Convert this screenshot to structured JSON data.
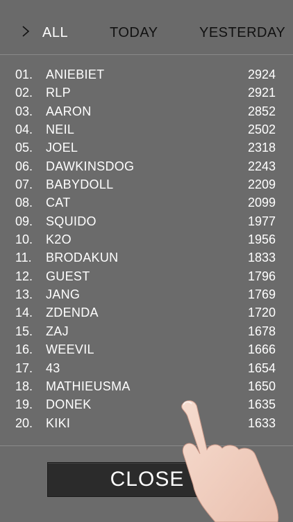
{
  "tabs": {
    "all": "ALL",
    "today": "TODAY",
    "yesterday": "YESTERDAY",
    "arrow_icon": "chevron-right-icon"
  },
  "leaderboard": [
    {
      "rank": "01.",
      "name": "ANIEBIET",
      "score": "2924"
    },
    {
      "rank": "02.",
      "name": "RLP",
      "score": "2921"
    },
    {
      "rank": "03.",
      "name": "AARON",
      "score": "2852"
    },
    {
      "rank": "04.",
      "name": "NEIL",
      "score": "2502"
    },
    {
      "rank": "05.",
      "name": "JOEL",
      "score": "2318"
    },
    {
      "rank": "06.",
      "name": "DAWKINSDOG",
      "score": "2243"
    },
    {
      "rank": "07.",
      "name": "BABYDOLL",
      "score": "2209"
    },
    {
      "rank": "08.",
      "name": "CAT",
      "score": "2099"
    },
    {
      "rank": "09.",
      "name": "SQUIDO",
      "score": "1977"
    },
    {
      "rank": "10.",
      "name": "K2O",
      "score": "1956"
    },
    {
      "rank": "11.",
      "name": "BRODAKUN",
      "score": "1833"
    },
    {
      "rank": "12.",
      "name": "GUEST",
      "score": "1796"
    },
    {
      "rank": "13.",
      "name": "JANG",
      "score": "1769"
    },
    {
      "rank": "14.",
      "name": "ZDENDA",
      "score": "1720"
    },
    {
      "rank": "15.",
      "name": "ZAJ",
      "score": "1678"
    },
    {
      "rank": "16.",
      "name": "WEEVIL",
      "score": "1666"
    },
    {
      "rank": "17.",
      "name": "43",
      "score": "1654"
    },
    {
      "rank": "18.",
      "name": "MATHIEUSMA",
      "score": "1650"
    },
    {
      "rank": "19.",
      "name": "DONEK",
      "score": "1635"
    },
    {
      "rank": "20.",
      "name": "KIKI",
      "score": "1633"
    }
  ],
  "close_button": {
    "label": "CLOSE"
  },
  "colors": {
    "background": "#6b6b6b",
    "button": "#2b2b2b",
    "text": "#ffffff",
    "inactive_tab": "#111111"
  }
}
